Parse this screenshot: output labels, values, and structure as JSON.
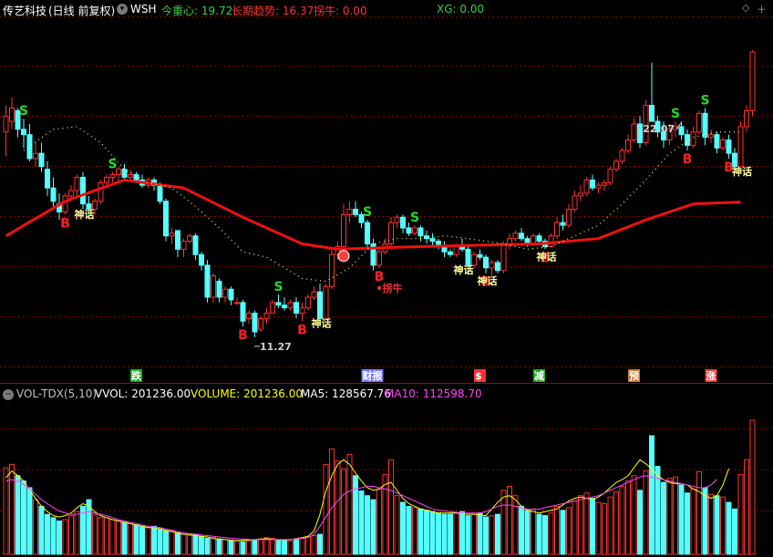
{
  "main_header": {
    "stock_name": "传艺科技",
    "period": "(日线 前复权)",
    "indicator": "WSH",
    "labels": [
      {
        "text": "今重心: 19.72",
        "color": "#3ed23e"
      },
      {
        "text": "长期趋势: 16.37",
        "color": "#ff3030"
      },
      {
        "text": "拐牛: 0.00",
        "color": "#ff3030"
      },
      {
        "text": "XG: 0.00",
        "color": "#3ed23e"
      }
    ]
  },
  "vol_header": {
    "name": "VOL-TDX(5,10)",
    "labels": [
      {
        "text": "VVOL: 201236.00",
        "color": "#ffffff"
      },
      {
        "text": "VOLUME: 201236.00",
        "color": "#ffff00"
      },
      {
        "text": "MA5: 128567.76",
        "color": "#ffffff"
      },
      {
        "text": "MA10: 112598.70",
        "color": "#ff44ff"
      }
    ]
  },
  "icons": {
    "menu": "gear-dropdown-icon",
    "diamond": "diamond-icon",
    "plus": "plus-icon",
    "minus": "minus-icon"
  },
  "colors": {
    "up": "#ff3030",
    "down": "#54ffff",
    "trend": "#ee1111",
    "dots_main": "#ffff66",
    "grid": "#8a0000",
    "ma5": "#ffff00",
    "ma10": "#ff44ff",
    "buy": "#ff2020",
    "sell": "#22dd22",
    "shenhua": "#ffff99"
  },
  "chart_data": {
    "type": "candlestick",
    "price_ylim": [
      10.2,
      23.2
    ],
    "volume_ylim": [
      0,
      230000
    ],
    "price_annotations": [
      {
        "text": "22.07",
        "index": 114
      },
      {
        "text": "11.27",
        "index": 42
      }
    ],
    "candles": [
      [
        19.0,
        20.0,
        18.1,
        19.6
      ],
      [
        19.4,
        20.3,
        19.1,
        19.9
      ],
      [
        19.8,
        19.9,
        18.8,
        19.1
      ],
      [
        19.1,
        19.5,
        18.4,
        18.9
      ],
      [
        18.9,
        19.3,
        17.9,
        18.0
      ],
      [
        18.0,
        18.6,
        17.7,
        18.2
      ],
      [
        18.2,
        18.6,
        17.5,
        17.7
      ],
      [
        17.6,
        17.9,
        16.6,
        16.9
      ],
      [
        16.9,
        17.3,
        16.2,
        16.4
      ],
      [
        16.3,
        16.7,
        15.7,
        16.0
      ],
      [
        16.0,
        16.7,
        15.9,
        16.6
      ],
      [
        16.6,
        17.0,
        16.4,
        16.8
      ],
      [
        16.8,
        17.4,
        16.6,
        17.3
      ],
      [
        17.3,
        17.5,
        16.1,
        16.3
      ],
      [
        16.3,
        16.6,
        15.9,
        16.1
      ],
      [
        16.1,
        16.5,
        15.9,
        16.4
      ],
      [
        16.4,
        17.2,
        16.3,
        17.1
      ],
      [
        17.1,
        17.4,
        16.9,
        17.3
      ],
      [
        17.3,
        17.5,
        17.1,
        17.4
      ],
      [
        17.4,
        17.7,
        17.1,
        17.6
      ],
      [
        17.6,
        17.8,
        17.2,
        17.3
      ],
      [
        17.3,
        17.6,
        17.2,
        17.4
      ],
      [
        17.4,
        17.5,
        17.1,
        17.2
      ],
      [
        17.2,
        17.4,
        16.9,
        17.0
      ],
      [
        17.0,
        17.3,
        16.9,
        17.2
      ],
      [
        17.2,
        17.3,
        16.8,
        17.0
      ],
      [
        17.0,
        17.1,
        16.3,
        16.4
      ],
      [
        16.4,
        16.5,
        14.9,
        15.1
      ],
      [
        15.1,
        15.4,
        14.8,
        15.2
      ],
      [
        15.3,
        15.3,
        14.3,
        14.6
      ],
      [
        14.6,
        15.0,
        14.3,
        14.9
      ],
      [
        14.9,
        15.2,
        14.8,
        15.1
      ],
      [
        15.1,
        15.2,
        14.2,
        14.4
      ],
      [
        14.4,
        14.5,
        13.8,
        14.0
      ],
      [
        14.0,
        14.2,
        12.6,
        12.8
      ],
      [
        12.8,
        13.7,
        12.6,
        13.6
      ],
      [
        13.4,
        13.5,
        12.6,
        12.8
      ],
      [
        12.8,
        13.2,
        12.6,
        13.1
      ],
      [
        13.1,
        13.2,
        12.5,
        12.7
      ],
      [
        12.6,
        12.8,
        12.5,
        12.6
      ],
      [
        12.6,
        12.7,
        11.7,
        11.9
      ],
      [
        12.0,
        12.3,
        11.8,
        12.2
      ],
      [
        12.2,
        12.3,
        11.3,
        11.5
      ],
      [
        11.6,
        12.1,
        11.5,
        12.0
      ],
      [
        12.0,
        12.4,
        11.8,
        12.2
      ],
      [
        12.2,
        12.7,
        12.2,
        12.6
      ],
      [
        12.6,
        12.9,
        12.4,
        12.5
      ],
      [
        12.5,
        12.8,
        12.3,
        12.4
      ],
      [
        12.4,
        12.7,
        12.3,
        12.6
      ],
      [
        12.6,
        12.8,
        12.0,
        12.2
      ],
      [
        12.2,
        12.6,
        11.9,
        12.4
      ],
      [
        12.4,
        12.9,
        12.3,
        12.8
      ],
      [
        12.8,
        13.2,
        12.7,
        13.0
      ],
      [
        13.0,
        13.3,
        11.7,
        12.0
      ],
      [
        12.0,
        13.3,
        12.0,
        13.2
      ],
      [
        13.2,
        14.6,
        13.1,
        14.4
      ],
      [
        14.4,
        14.9,
        14.2,
        14.7
      ],
      [
        14.7,
        16.3,
        14.6,
        15.9
      ],
      [
        15.9,
        16.4,
        15.6,
        16.1
      ],
      [
        16.1,
        16.4,
        15.8,
        15.9
      ],
      [
        15.9,
        16.0,
        15.4,
        15.6
      ],
      [
        15.6,
        15.7,
        14.6,
        14.8
      ],
      [
        14.8,
        15.0,
        13.8,
        14.0
      ],
      [
        14.0,
        14.6,
        13.9,
        14.5
      ],
      [
        14.5,
        15.0,
        14.4,
        14.8
      ],
      [
        14.8,
        15.8,
        14.7,
        15.6
      ],
      [
        15.6,
        15.9,
        15.4,
        15.8
      ],
      [
        15.8,
        15.9,
        15.2,
        15.4
      ],
      [
        15.4,
        15.6,
        15.1,
        15.2
      ],
      [
        15.2,
        15.5,
        15.1,
        15.4
      ],
      [
        15.4,
        15.5,
        14.9,
        15.1
      ],
      [
        15.1,
        15.3,
        14.8,
        15.0
      ],
      [
        15.0,
        15.2,
        14.7,
        14.9
      ],
      [
        14.9,
        15.0,
        14.6,
        14.7
      ],
      [
        14.7,
        14.9,
        14.3,
        14.5
      ],
      [
        14.5,
        14.6,
        14.3,
        14.4
      ],
      [
        14.4,
        14.8,
        14.3,
        14.7
      ],
      [
        14.7,
        15.0,
        14.5,
        14.6
      ],
      [
        14.6,
        14.7,
        13.8,
        14.0
      ],
      [
        14.0,
        14.5,
        13.9,
        14.4
      ],
      [
        14.4,
        14.6,
        14.2,
        14.3
      ],
      [
        14.3,
        14.4,
        13.7,
        13.9
      ],
      [
        13.9,
        14.2,
        13.6,
        14.1
      ],
      [
        14.1,
        14.2,
        13.7,
        13.8
      ],
      [
        13.8,
        14.9,
        13.7,
        14.8
      ],
      [
        14.8,
        15.2,
        14.6,
        15.0
      ],
      [
        15.0,
        15.3,
        14.9,
        15.2
      ],
      [
        15.2,
        15.4,
        14.9,
        15.0
      ],
      [
        15.0,
        15.1,
        14.7,
        14.8
      ],
      [
        14.8,
        15.2,
        14.8,
        15.1
      ],
      [
        15.1,
        15.2,
        14.8,
        14.9
      ],
      [
        14.9,
        15.0,
        14.6,
        14.7
      ],
      [
        14.7,
        15.2,
        14.7,
        15.1
      ],
      [
        15.1,
        15.8,
        15.0,
        15.6
      ],
      [
        15.6,
        15.9,
        15.3,
        15.5
      ],
      [
        15.5,
        16.3,
        15.4,
        16.1
      ],
      [
        16.1,
        16.8,
        16.0,
        16.6
      ],
      [
        16.6,
        17.0,
        16.4,
        16.7
      ],
      [
        16.7,
        17.3,
        16.6,
        17.2
      ],
      [
        17.2,
        17.4,
        16.8,
        16.9
      ],
      [
        16.9,
        17.1,
        16.7,
        17.0
      ],
      [
        17.0,
        17.2,
        16.8,
        17.1
      ],
      [
        17.1,
        17.7,
        17.0,
        17.6
      ],
      [
        17.6,
        18.0,
        17.5,
        17.9
      ],
      [
        17.9,
        18.4,
        17.8,
        18.3
      ],
      [
        18.3,
        18.9,
        18.2,
        18.7
      ],
      [
        18.7,
        19.5,
        18.6,
        19.3
      ],
      [
        19.3,
        19.6,
        18.4,
        18.6
      ],
      [
        18.6,
        20.2,
        18.5,
        20.0
      ],
      [
        20.0,
        21.6,
        19.6,
        19.4
      ],
      [
        19.4,
        19.6,
        18.8,
        19.0
      ],
      [
        19.0,
        19.4,
        18.4,
        18.7
      ],
      [
        18.7,
        19.3,
        18.5,
        19.1
      ],
      [
        19.1,
        19.4,
        18.8,
        19.2
      ],
      [
        19.2,
        19.4,
        18.7,
        18.9
      ],
      [
        18.9,
        19.1,
        18.3,
        18.5
      ],
      [
        18.5,
        19.2,
        18.4,
        19.0
      ],
      [
        19.0,
        19.8,
        18.9,
        19.7
      ],
      [
        19.7,
        19.9,
        18.5,
        18.8
      ],
      [
        18.8,
        19.1,
        18.6,
        18.9
      ],
      [
        18.9,
        19.0,
        18.2,
        18.4
      ],
      [
        18.4,
        18.8,
        18.3,
        18.7
      ],
      [
        18.7,
        18.9,
        18.0,
        18.2
      ],
      [
        18.2,
        18.4,
        17.5,
        17.7
      ],
      [
        17.7,
        19.4,
        17.6,
        19.2
      ],
      [
        19.2,
        20.0,
        19.0,
        19.8
      ],
      [
        19.8,
        22.07,
        19.6,
        22.0
      ]
    ],
    "volume": [
      130000,
      135000,
      118000,
      110000,
      100000,
      82000,
      72000,
      60000,
      55000,
      50000,
      52000,
      58000,
      64000,
      72000,
      82000,
      60000,
      55000,
      55000,
      52000,
      50000,
      48000,
      46000,
      44000,
      42000,
      40000,
      42000,
      38000,
      35000,
      36000,
      32000,
      30000,
      28000,
      30000,
      26000,
      24000,
      25000,
      23000,
      22000,
      21000,
      20000,
      19000,
      20000,
      21000,
      23000,
      25000,
      24000,
      22000,
      21000,
      20000,
      22000,
      24000,
      26000,
      28000,
      30000,
      135000,
      158000,
      140000,
      128000,
      150000,
      118000,
      95000,
      88000,
      82000,
      98000,
      120000,
      142000,
      88000,
      78000,
      72000,
      70000,
      68000,
      66000,
      64000,
      62000,
      60000,
      60000,
      62000,
      64000,
      58000,
      60000,
      62000,
      56000,
      58000,
      60000,
      96000,
      102000,
      88000,
      72000,
      66000,
      68000,
      60000,
      58000,
      62000,
      72000,
      66000,
      70000,
      80000,
      88000,
      92000,
      84000,
      78000,
      76000,
      86000,
      94000,
      102000,
      110000,
      118000,
      96000,
      125000,
      178000,
      132000,
      108000,
      114000,
      116000,
      104000,
      92000,
      98000,
      124000,
      100000,
      90000,
      88000,
      86000,
      78000,
      68000,
      120000,
      142000,
      201236
    ],
    "trend_line": [
      [
        0,
        15.1
      ],
      [
        10,
        16.4
      ],
      [
        20,
        17.2
      ],
      [
        30,
        16.9
      ],
      [
        40,
        15.8
      ],
      [
        50,
        14.8
      ],
      [
        56,
        14.6
      ],
      [
        70,
        14.7
      ],
      [
        90,
        14.8
      ],
      [
        100,
        15.0
      ],
      [
        108,
        15.7
      ],
      [
        116,
        16.3
      ],
      [
        124,
        16.37
      ]
    ],
    "dotted_line_main": [
      [
        3,
        18.3
      ],
      [
        8,
        19.1
      ],
      [
        12,
        19.2
      ],
      [
        16,
        18.6
      ],
      [
        20,
        17.6
      ],
      [
        24,
        17.1
      ],
      [
        28,
        16.9
      ],
      [
        32,
        16.2
      ],
      [
        36,
        15.4
      ],
      [
        40,
        14.5
      ],
      [
        44,
        14.3
      ],
      [
        50,
        13.5
      ],
      [
        54,
        13.4
      ],
      [
        58,
        13.9
      ],
      [
        62,
        14.8
      ],
      [
        66,
        15.0
      ],
      [
        70,
        15.0
      ],
      [
        74,
        15.1
      ],
      [
        78,
        15.0
      ],
      [
        84,
        14.8
      ],
      [
        88,
        14.6
      ],
      [
        92,
        14.7
      ],
      [
        96,
        15.1
      ],
      [
        100,
        15.5
      ],
      [
        104,
        16.3
      ],
      [
        108,
        17.2
      ],
      [
        112,
        18.2
      ],
      [
        116,
        18.8
      ],
      [
        120,
        19.0
      ],
      [
        124,
        19.0
      ]
    ],
    "volume_ma5": [
      115000,
      125000,
      118000,
      110000,
      96000,
      84000,
      72000,
      64000,
      58000,
      56000,
      58000,
      62000,
      70000,
      76000,
      72000,
      64000,
      58000,
      55000,
      52000,
      50000,
      48000,
      46000,
      44000,
      42000,
      40000,
      40000,
      38000,
      36000,
      34000,
      32000,
      30000,
      30000,
      28000,
      27000,
      26000,
      24000,
      23000,
      22000,
      21000,
      20500,
      21000,
      21500,
      22000,
      23000,
      23500,
      22500,
      21500,
      21500,
      22000,
      23500,
      25000,
      27000,
      35000,
      60000,
      95000,
      118000,
      135000,
      142000,
      135000,
      122000,
      110000,
      100000,
      96000,
      98000,
      105000,
      108000,
      96000,
      84000,
      76000,
      72000,
      68000,
      66000,
      64000,
      62000,
      62000,
      62000,
      62000,
      61000,
      60000,
      60000,
      59000,
      58000,
      68000,
      78000,
      86000,
      88000,
      82000,
      72000,
      66000,
      64000,
      62000,
      64000,
      66000,
      68000,
      74000,
      80000,
      84000,
      86000,
      84000,
      82000,
      86000,
      92000,
      100000,
      108000,
      112000,
      118000,
      130000,
      142000,
      136000,
      128000,
      118000,
      112000,
      108000,
      106000,
      106000,
      104000,
      98000,
      94000,
      88000,
      84000,
      88000,
      104000,
      128567
    ],
    "volume_ma10": [
      110000,
      112000,
      110000,
      105000,
      98000,
      90000,
      82000,
      76000,
      70000,
      65000,
      62000,
      60000,
      60000,
      62000,
      64000,
      62000,
      60000,
      58000,
      55000,
      52000,
      50000,
      48000,
      46000,
      44000,
      42000,
      41000,
      40000,
      38000,
      36000,
      34000,
      32000,
      31000,
      30000,
      29000,
      28000,
      27000,
      26000,
      25000,
      24000,
      23500,
      23000,
      22500,
      22000,
      22000,
      22000,
      22000,
      22000,
      22000,
      22500,
      23000,
      24000,
      25000,
      30000,
      42000,
      56000,
      70000,
      80000,
      90000,
      95000,
      98000,
      100000,
      102000,
      102000,
      100000,
      98000,
      96000,
      92000,
      88000,
      84000,
      80000,
      76000,
      72000,
      68000,
      66000,
      65000,
      64000,
      63000,
      62000,
      62000,
      62000,
      62000,
      64000,
      68000,
      72000,
      74000,
      74000,
      72000,
      70000,
      68000,
      67000,
      68000,
      70000,
      72000,
      74000,
      76000,
      78000,
      80000,
      82000,
      84000,
      86000,
      88000,
      92000,
      96000,
      100000,
      104000,
      108000,
      112000,
      116000,
      118000,
      116000,
      114000,
      112000,
      110000,
      108000,
      106000,
      104000,
      102000,
      100000,
      100000,
      104000,
      112598
    ],
    "signals": [
      {
        "text": "S",
        "index": 3,
        "kind": "sell"
      },
      {
        "text": "B",
        "index": 10,
        "kind": "buy"
      },
      {
        "text": "S",
        "index": 18,
        "kind": "sell"
      },
      {
        "text": "B",
        "index": 40,
        "kind": "buy"
      },
      {
        "text": "S",
        "index": 46,
        "kind": "sell"
      },
      {
        "text": "B",
        "index": 50,
        "kind": "buy"
      },
      {
        "text": "S",
        "index": 61,
        "kind": "sell"
      },
      {
        "text": "B",
        "index": 63,
        "kind": "buy"
      },
      {
        "text": "S",
        "index": 69,
        "kind": "sell"
      },
      {
        "text": "B",
        "index": 81,
        "kind": "buy"
      },
      {
        "text": "B",
        "index": 91,
        "kind": "buy"
      },
      {
        "text": "S",
        "index": 113,
        "kind": "sell"
      },
      {
        "text": "B",
        "index": 115,
        "kind": "buy"
      },
      {
        "text": "S",
        "index": 118,
        "kind": "sell"
      },
      {
        "text": "B",
        "index": 122,
        "kind": "buy"
      }
    ],
    "shenhua_marks": [
      {
        "text": "神话",
        "index": 11
      },
      {
        "text": "神话",
        "index": 51
      },
      {
        "text": "神话",
        "index": 75
      },
      {
        "text": "神话",
        "index": 79
      },
      {
        "text": "神话",
        "index": 89
      },
      {
        "text": "神话",
        "index": 122
      }
    ],
    "guainiu_mark": {
      "text": "拐牛",
      "index": 63
    },
    "bottom_tags": [
      {
        "text": "跌",
        "index": 22,
        "color": "#22aa22"
      },
      {
        "text": "财报",
        "index": 61,
        "color": "#7777ff"
      },
      {
        "text": "$",
        "index": 80,
        "color": "#ff3030"
      },
      {
        "text": "减",
        "index": 90,
        "color": "#22aa22"
      },
      {
        "text": "预",
        "index": 106,
        "color": "#cc7733"
      },
      {
        "text": "涨",
        "index": 119,
        "color": "#ff3030"
      }
    ]
  }
}
